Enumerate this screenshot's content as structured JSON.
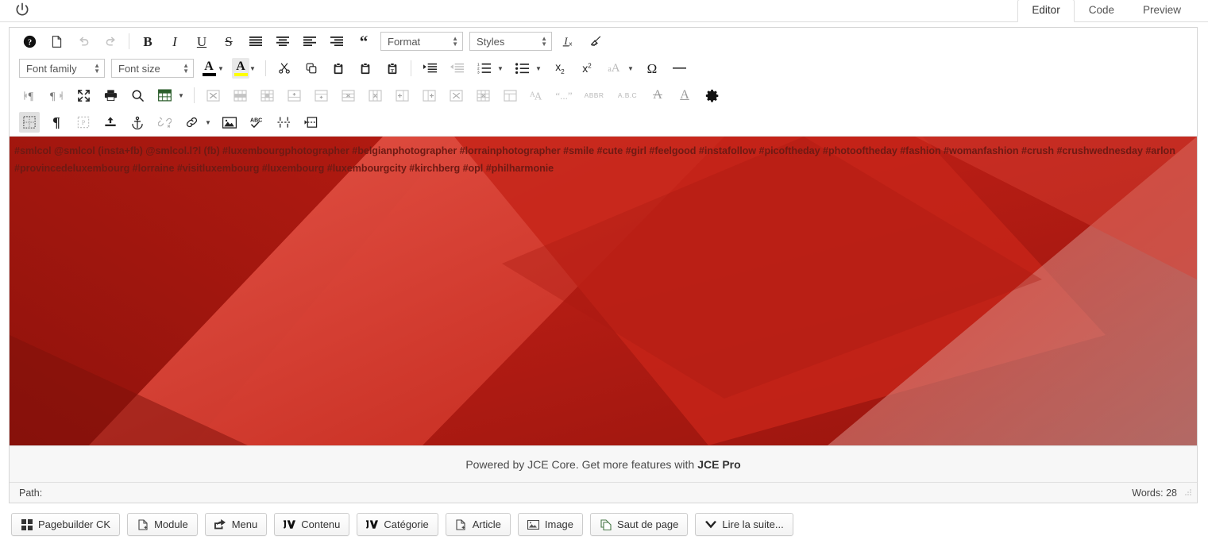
{
  "window": {
    "power_icon": "power-icon"
  },
  "tabs": [
    {
      "label": "Editor",
      "active": true
    },
    {
      "label": "Code",
      "active": false
    },
    {
      "label": "Preview",
      "active": false
    }
  ],
  "toolbar": {
    "row1": [
      {
        "name": "help-button",
        "icon": "help-circle-icon",
        "label": "Help"
      },
      {
        "name": "new-document-button",
        "icon": "new-document-icon",
        "label": "New document"
      },
      {
        "name": "undo-button",
        "icon": "undo-icon",
        "label": "Undo",
        "state": "disabled"
      },
      {
        "name": "redo-button",
        "icon": "redo-icon",
        "label": "Redo",
        "state": "disabled"
      },
      {
        "name": "bold-button",
        "icon": "bold-icon",
        "label": "Bold"
      },
      {
        "name": "italic-button",
        "icon": "italic-icon",
        "label": "Italic"
      },
      {
        "name": "underline-button",
        "icon": "underline-icon",
        "label": "Underline"
      },
      {
        "name": "strikethrough-button",
        "icon": "strikethrough-icon",
        "label": "Strikethrough"
      },
      {
        "name": "align-justify-button",
        "icon": "align-justify-icon",
        "label": "Justify"
      },
      {
        "name": "align-center-button",
        "icon": "align-center-icon",
        "label": "Align center"
      },
      {
        "name": "align-left-button",
        "icon": "align-left-icon",
        "label": "Align left"
      },
      {
        "name": "align-right-button",
        "icon": "align-right-icon",
        "label": "Align right"
      },
      {
        "name": "blockquote-button",
        "icon": "quote-icon",
        "label": "Blockquote"
      }
    ],
    "format_select": {
      "value": "Format"
    },
    "styles_select": {
      "value": "Styles"
    },
    "row1_end": [
      {
        "name": "remove-format-button",
        "icon": "remove-format-icon",
        "label": "Remove formatting"
      },
      {
        "name": "cleanup-button",
        "icon": "broom-icon",
        "label": "Clean up messy code"
      }
    ],
    "font_family_select": {
      "value": "Font family"
    },
    "font_size_select": {
      "value": "Font size"
    },
    "row2": [
      {
        "name": "forecolor-button",
        "icon": "text-color-icon",
        "label": "Text colour",
        "color": "#000000"
      },
      {
        "name": "backcolor-button",
        "icon": "background-color-icon",
        "label": "Background colour",
        "color": "#ffff00"
      },
      {
        "name": "cut-button",
        "icon": "scissors-icon",
        "label": "Cut"
      },
      {
        "name": "copy-button",
        "icon": "copy-icon",
        "label": "Copy"
      },
      {
        "name": "paste-button",
        "icon": "paste-icon",
        "label": "Paste"
      },
      {
        "name": "paste-plain-button",
        "icon": "paste-plain-icon",
        "label": "Paste as plain text"
      },
      {
        "name": "paste-text-button",
        "icon": "paste-text-icon",
        "label": "Paste as text"
      },
      {
        "name": "indent-button",
        "icon": "indent-icon",
        "label": "Increase indent"
      },
      {
        "name": "outdent-button",
        "icon": "outdent-icon",
        "label": "Decrease indent",
        "state": "disabled"
      },
      {
        "name": "numbered-list-button",
        "icon": "numbered-list-icon",
        "label": "Numbered list"
      },
      {
        "name": "bullet-list-button",
        "icon": "bullet-list-icon",
        "label": "Bullet list"
      },
      {
        "name": "subscript-button",
        "icon": "subscript-icon",
        "label": "Subscript"
      },
      {
        "name": "superscript-button",
        "icon": "superscript-icon",
        "label": "Superscript"
      },
      {
        "name": "change-case-button",
        "icon": "change-case-icon",
        "label": "Change case",
        "state": "disabled"
      },
      {
        "name": "special-character-button",
        "icon": "omega-icon",
        "label": "Insert special character"
      },
      {
        "name": "horizontal-rule-button",
        "icon": "horizontal-rule-icon",
        "label": "Insert horizontal rule"
      }
    ],
    "row3": [
      {
        "name": "direction-ltr-button",
        "icon": "direction-ltr-icon",
        "label": "Left to right",
        "state": "faded"
      },
      {
        "name": "direction-rtl-button",
        "icon": "direction-rtl-icon",
        "label": "Right to left",
        "state": "faded"
      },
      {
        "name": "fullscreen-button",
        "icon": "fullscreen-icon",
        "label": "Toggle fullscreen"
      },
      {
        "name": "print-button",
        "icon": "printer-icon",
        "label": "Print"
      },
      {
        "name": "search-replace-button",
        "icon": "search-icon",
        "label": "Find and replace"
      },
      {
        "name": "insert-table-button",
        "icon": "table-icon",
        "label": "Insert table"
      },
      {
        "name": "delete-table-button",
        "icon": "table-delete-icon",
        "label": "Delete table",
        "state": "faded"
      },
      {
        "name": "table-row-properties-button",
        "icon": "table-row-props-icon",
        "label": "Row properties",
        "state": "faded"
      },
      {
        "name": "table-cell-properties-button",
        "icon": "table-cell-props-icon",
        "label": "Cell properties",
        "state": "faded"
      },
      {
        "name": "table-insert-row-before-button",
        "icon": "table-row-before-icon",
        "label": "Insert row before",
        "state": "faded"
      },
      {
        "name": "table-insert-row-after-button",
        "icon": "table-row-after-icon",
        "label": "Insert row after",
        "state": "faded"
      },
      {
        "name": "table-delete-row-button",
        "icon": "table-delete-row-icon",
        "label": "Delete row",
        "state": "faded"
      },
      {
        "name": "table-delete-col-button",
        "icon": "table-delete-col-icon",
        "label": "Delete column",
        "state": "faded"
      },
      {
        "name": "table-insert-col-before-button",
        "icon": "table-col-before-icon",
        "label": "Insert column before",
        "state": "faded"
      },
      {
        "name": "table-insert-col-after-button",
        "icon": "table-col-after-icon",
        "label": "Insert column after",
        "state": "faded"
      },
      {
        "name": "table-split-cells-button",
        "icon": "table-split-cells-icon",
        "label": "Split merged cells",
        "state": "faded"
      },
      {
        "name": "table-merge-cells-button",
        "icon": "table-merge-cells-icon",
        "label": "Merge cells",
        "state": "faded"
      },
      {
        "name": "table-properties-button",
        "icon": "table-properties-icon",
        "label": "Table properties",
        "state": "faded"
      },
      {
        "name": "font-size-toggle-button",
        "icon": "font-size-aa-icon",
        "label": "Font size",
        "state": "faded"
      },
      {
        "name": "inline-quote-button",
        "icon": "inline-quote-icon",
        "label": "Quotation",
        "state": "faded"
      },
      {
        "name": "abbreviation-button",
        "icon": "abbr-icon",
        "label": "ABBR",
        "state": "faded"
      },
      {
        "name": "acronym-button",
        "icon": "acronym-icon",
        "label": "A.B.C"
      },
      {
        "name": "delete-text-button",
        "icon": "del-text-icon",
        "label": "Deleted text",
        "state": "faded"
      },
      {
        "name": "insert-text-button",
        "icon": "ins-text-icon",
        "label": "Inserted text",
        "state": "faded"
      },
      {
        "name": "editor-settings-button",
        "icon": "gear-icon",
        "label": "Editor settings"
      }
    ],
    "row4": [
      {
        "name": "visual-aid-button",
        "icon": "visual-aid-icon",
        "label": "Toggle guidelines/invisible elements",
        "state": "pressed"
      },
      {
        "name": "show-blocks-button",
        "icon": "paragraph-icon",
        "label": "Show blocks"
      },
      {
        "name": "visual-characters-button",
        "icon": "visual-characters-icon",
        "label": "Show invisible characters",
        "state": "faded"
      },
      {
        "name": "file-browser-button",
        "icon": "upload-icon",
        "label": "File browser"
      },
      {
        "name": "anchor-button",
        "icon": "anchor-icon",
        "label": "Insert anchor"
      },
      {
        "name": "unlink-button",
        "icon": "unlink-icon",
        "label": "Unlink",
        "state": "faded"
      },
      {
        "name": "link-button",
        "icon": "link-icon",
        "label": "Insert/edit link"
      },
      {
        "name": "image-button",
        "icon": "image-icon",
        "label": "Insert/edit image"
      },
      {
        "name": "spellcheck-button",
        "icon": "spellcheck-icon",
        "label": "Spellcheck"
      },
      {
        "name": "page-break-button",
        "icon": "page-break-icon",
        "label": "Insert page break"
      },
      {
        "name": "read-more-button",
        "icon": "read-more-icon",
        "label": "Insert read more"
      }
    ]
  },
  "content": {
    "background_color": "#b51b13",
    "text_color": "#6e1a14",
    "paragraphs": [
      "#smlcol @smlcol (insta+fb) @smlcol.l?l (fb) #luxembourgphotographer #belgianphotographer #lorrainphotographer #smile #cute #girl #feelgood #instafollow #picoftheday #photooftheday #fashion #womanfashion #crush #crushwednesday #arlon",
      "#provincedeluxembourg #lorraine #visitluxembourg #luxembourg #luxembourgcity #kirchberg #opl #philharmonie"
    ]
  },
  "promo": {
    "text": "Powered by JCE Core. Get more features with",
    "link": "JCE Pro"
  },
  "statusbar": {
    "path_label": "Path:",
    "path_value": "",
    "word_count": "Words: 28",
    "resize_grip": "resize-grip-icon"
  },
  "bottom_buttons": [
    {
      "name": "pagebuilder-ck-button",
      "label": "Pagebuilder CK",
      "icon": "grid-icon"
    },
    {
      "name": "module-button",
      "label": "Module",
      "icon": "file-plus-icon"
    },
    {
      "name": "menu-button",
      "label": "Menu",
      "icon": "share-icon"
    },
    {
      "name": "contenu-button",
      "label": "Contenu",
      "icon": "jv-icon"
    },
    {
      "name": "categorie-button",
      "label": "Catégorie",
      "icon": "jv-icon"
    },
    {
      "name": "article-button",
      "label": "Article",
      "icon": "file-plus-icon"
    },
    {
      "name": "image-insert-button",
      "label": "Image",
      "icon": "picture-icon"
    },
    {
      "name": "saut-de-page-button",
      "label": "Saut de page",
      "icon": "pages-icon"
    },
    {
      "name": "lire-la-suite-button",
      "label": "Lire la suite...",
      "icon": "chevron-down-icon"
    }
  ]
}
